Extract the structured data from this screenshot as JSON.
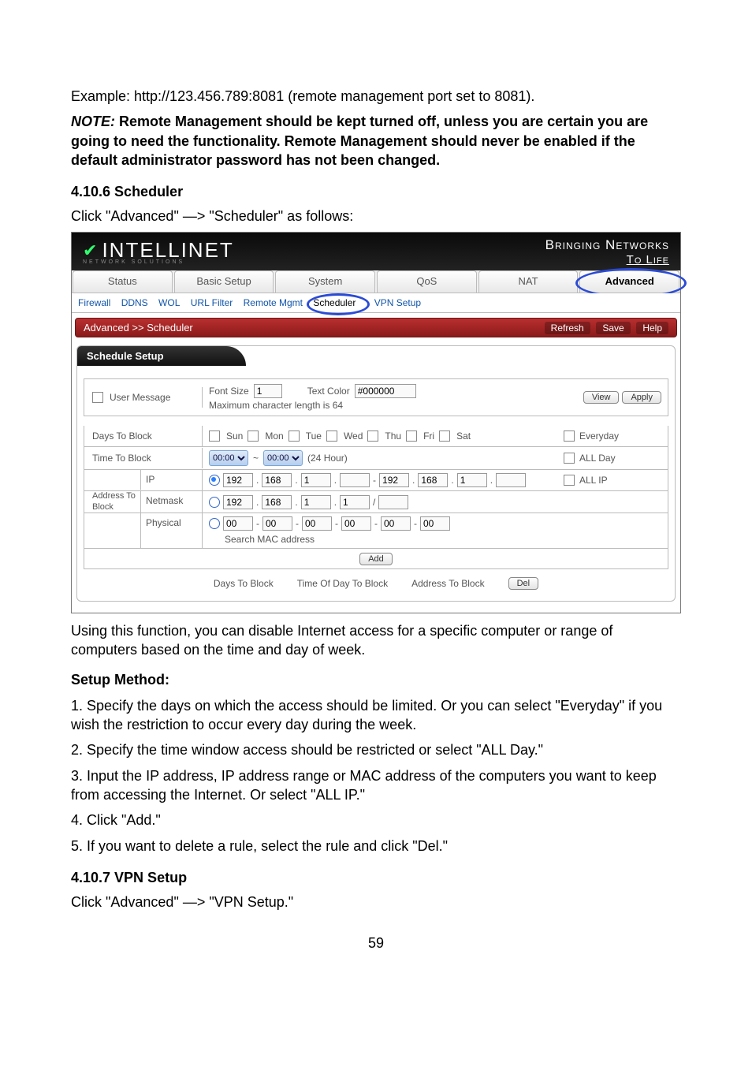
{
  "intro": {
    "example": "Example: http://123.456.789:8081 (remote management port set to 8081).",
    "note_prefix": "NOTE:",
    "note_body": " Remote Management should be kept turned off, unless you are certain you are going to need the functionality. Remote Management should never be enabled if the default administrator password has not been changed."
  },
  "sec_scheduler": {
    "heading": "4.10.6 Scheduler",
    "lead": "Click \"Advanced\" —> \"Scheduler\" as follows:"
  },
  "shot": {
    "brand": "INTELLINET",
    "brand_sub": "NETWORK SOLUTIONS",
    "tagline_top": "Bringing Networks",
    "tagline_bottom": "To Life",
    "tabs": [
      "Status",
      "Basic Setup",
      "System",
      "QoS",
      "NAT",
      "Advanced"
    ],
    "active_tab": 5,
    "subnav": [
      "Firewall",
      "DDNS",
      "WOL",
      "URL Filter",
      "Remote Mgmt",
      "Scheduler",
      "VPN Setup"
    ],
    "subnav_sel": 5,
    "breadcrumb": "Advanced >> Scheduler",
    "bc_actions": [
      "Refresh",
      "Save",
      "Help"
    ],
    "panel_title": "Schedule Setup",
    "user_message": {
      "label": "User Message",
      "font_size_label": "Font Size",
      "font_size_value": "1",
      "text_color_label": "Text Color",
      "text_color_value": "#000000",
      "max_len": "Maximum character length is 64",
      "view_btn": "View",
      "apply_btn": "Apply"
    },
    "days": {
      "label": "Days To Block",
      "items": [
        "Sun",
        "Mon",
        "Tue",
        "Wed",
        "Thu",
        "Fri",
        "Sat"
      ],
      "everyday": "Everyday"
    },
    "time": {
      "label": "Time To Block",
      "from": "00:00",
      "to": "00:00",
      "tilde": "~",
      "hint": "(24 Hour)",
      "allday": "ALL Day"
    },
    "addr": {
      "group_label": "Address To Block",
      "rows": {
        "ip": {
          "label": "IP",
          "a": [
            "192",
            "168",
            "1",
            ""
          ],
          "dash": "-",
          "b": [
            "192",
            "168",
            "1",
            ""
          ],
          "allip": "ALL IP"
        },
        "netmask": {
          "label": "Netmask",
          "a": [
            "192",
            "168",
            "1",
            "1"
          ],
          "slash": "/"
        },
        "physical": {
          "label": "Physical",
          "mac": [
            "00",
            "00",
            "00",
            "00",
            "00",
            "00"
          ],
          "search": "Search MAC address"
        }
      }
    },
    "add_btn": "Add",
    "bottom": {
      "c1": "Days To Block",
      "c2": "Time Of Day To Block",
      "c3": "Address To Block",
      "del": "Del"
    }
  },
  "after": {
    "p1": "Using this function, you can disable Internet access for a specific computer or range of computers based on the time and day of week.",
    "setup_hdr": "Setup Method:",
    "s1": "1. Specify the days on which the access should be limited. Or you can select \"Everyday\" if you wish the restriction to occur every day during the week.",
    "s2": "2. Specify the time window access should be restricted or select \"ALL Day.\"",
    "s3": "3. Input the IP address, IP address range or MAC address of the computers you want to keep from accessing the Internet. Or select \"ALL IP.\"",
    "s4": "4. Click \"Add.\"",
    "s5": "5. If you want to delete a rule, select the rule and click \"Del.\""
  },
  "sec_vpn": {
    "heading": "4.10.7 VPN Setup",
    "lead": "Click \"Advanced\" —> \"VPN Setup.\""
  },
  "page_number": "59"
}
